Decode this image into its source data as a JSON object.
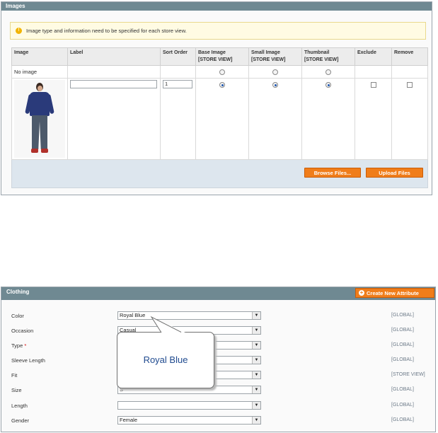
{
  "images": {
    "title": "Images",
    "notice": "Image type and information need to be specified for each store view.",
    "columns": {
      "image": "Image",
      "label": "Label",
      "sort_order": "Sort Order",
      "base_image": "Base Image",
      "small_image": "Small Image",
      "thumbnail": "Thumbnail",
      "store_view": "[STORE VIEW]",
      "exclude": "Exclude",
      "remove": "Remove"
    },
    "no_image_label": "No image",
    "row": {
      "sort_order": "1",
      "base_image": true,
      "small_image": true,
      "thumbnail": true,
      "exclude": false,
      "remove": false
    },
    "browse_button": "Browse Files...",
    "upload_button": "Upload Files"
  },
  "clothing": {
    "title": "Clothing",
    "create_button": "Create New Attribute",
    "attributes": [
      {
        "label": "Color",
        "required": false,
        "value": "Royal Blue",
        "scope": "[GLOBAL]"
      },
      {
        "label": "Occasion",
        "required": false,
        "value": "Casual",
        "scope": "[GLOBAL]"
      },
      {
        "label": "Type",
        "required": true,
        "value": "",
        "scope": "[GLOBAL]"
      },
      {
        "label": "Sleeve Length",
        "required": false,
        "value": "",
        "scope": "[GLOBAL]"
      },
      {
        "label": "Fit",
        "required": false,
        "value": "",
        "scope": "[STORE VIEW]"
      },
      {
        "label": "Size",
        "required": false,
        "value": "S",
        "scope": "[GLOBAL]"
      },
      {
        "label": "Length",
        "required": false,
        "value": "",
        "scope": "[GLOBAL]"
      },
      {
        "label": "Gender",
        "required": false,
        "value": "Female",
        "scope": "[GLOBAL]"
      }
    ],
    "required_marker": "*"
  },
  "callout": {
    "text": "Royal Blue"
  },
  "colors": {
    "header": "#6f8992",
    "accent": "#f07d1a",
    "footer_bar": "#dde6ee",
    "notice_bg": "#fffbe3"
  }
}
